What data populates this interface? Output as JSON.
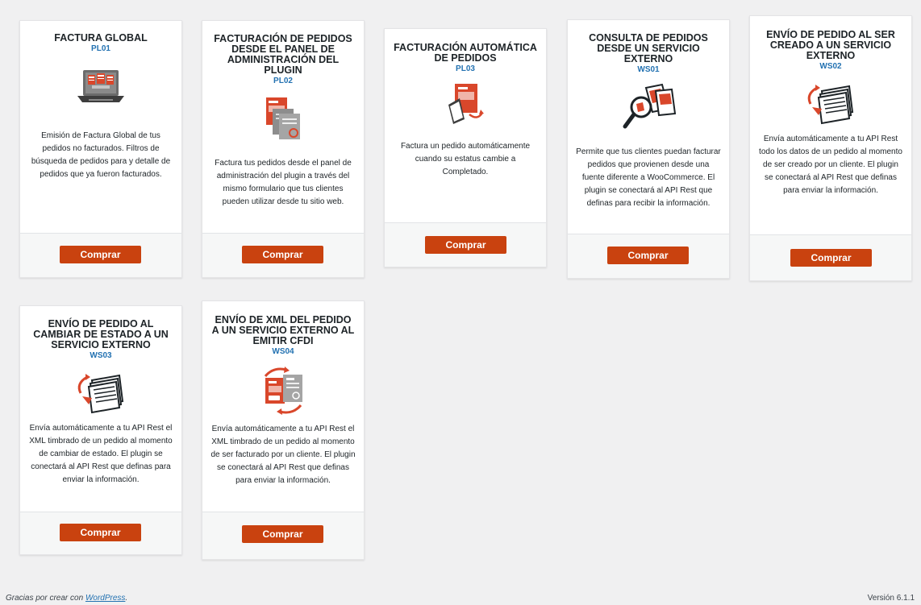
{
  "brand": {
    "accent": "#c9420f",
    "link": "#2271b1"
  },
  "products": [
    {
      "title": "FACTURA GLOBAL",
      "code": "PL01",
      "icon": "laptop-invoices-icon",
      "description": "Emisión de Factura Global de tus pedidos no facturados. Filtros de búsqueda de pedidos para y detalle de pedidos que ya fueron facturados.",
      "button_label": "Comprar"
    },
    {
      "title": "FACTURACIÓN DE PEDIDOS DESDE EL PANEL DE ADMINISTRACIÓN DEL PLUGIN",
      "code": "PL02",
      "icon": "invoice-stack-icon",
      "description": "Factura tus pedidos desde el panel de administración del plugin a través del mismo formulario que tus clientes pueden utilizar desde tu sitio web.",
      "button_label": "Comprar"
    },
    {
      "title": "FACTURACIÓN AUTOMÁTICA DE PEDIDOS",
      "code": "PL03",
      "icon": "auto-invoice-icon",
      "description": "Factura un pedido automáticamente cuando su estatus cambie a Completado.",
      "button_label": "Comprar"
    },
    {
      "title": "CONSULTA DE PEDIDOS DESDE UN SERVICIO EXTERNO",
      "code": "WS01",
      "icon": "search-documents-icon",
      "description": "Permite que tus clientes puedan facturar pedidos que provienen desde una fuente diferente a WooCommerce. El plugin se conectará al API Rest que definas para recibir la información.",
      "button_label": "Comprar"
    },
    {
      "title": "ENVÍO DE PEDIDO AL SER CREADO A UN SERVICIO EXTERNO",
      "code": "WS02",
      "icon": "paper-stack-icon",
      "description": "Envía automáticamente a tu API Rest todo los datos de un pedido al momento de ser creado por un cliente. El plugin se conectará al API Rest que definas para enviar la información.",
      "button_label": "Comprar"
    },
    {
      "title": "ENVÍO DE PEDIDO AL CAMBIAR DE ESTADO A UN SERVICIO EXTERNO",
      "code": "WS03",
      "icon": "paper-stack-icon",
      "description": "Envía automáticamente a tu API Rest el XML timbrado de un pedido al momento de cambiar de estado. El plugin se conectará al API Rest que definas para enviar la información.",
      "button_label": "Comprar"
    },
    {
      "title": "ENVÍO DE XML DEL PEDIDO A UN SERVICIO EXTERNO AL EMITIR CFDI",
      "code": "WS04",
      "icon": "xml-exchange-icon",
      "description": "Envía automáticamente a tu API Rest el XML timbrado de un pedido al momento de ser facturado por un cliente. El plugin se conectará al API Rest que definas para enviar la información.",
      "button_label": "Comprar"
    }
  ],
  "footer": {
    "thanks_prefix": "Gracias por crear con ",
    "thanks_link": "WordPress",
    "thanks_suffix": ".",
    "version": "Versión 6.1.1"
  }
}
